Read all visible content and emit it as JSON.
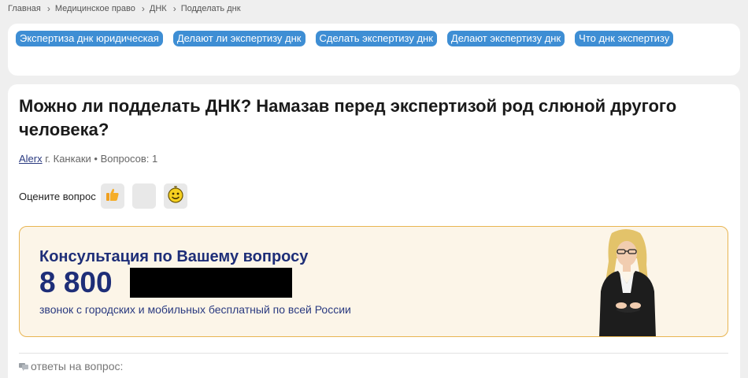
{
  "breadcrumb": {
    "items": [
      "Главная",
      "Медицинское право",
      "ДНК",
      "Подделать днк"
    ],
    "separator_icon": "chevron-right-icon"
  },
  "tags": [
    "Экспертиза днк юридическая",
    "Делают ли экспертизу днк",
    "Сделать экспертизу днк",
    "Делают экспертизу днк",
    "Что днк экспертизу"
  ],
  "question": {
    "title": "Можно ли подделать ДНК? Намазав перед экспертизой род слюной другого человека?",
    "author": "Alerx",
    "location": "г. Канкаки",
    "questions_count": "Вопросов: 1"
  },
  "rating": {
    "label": "Оцените вопрос",
    "icons": [
      "thumbs-up-icon",
      "neutral-icon",
      "smiley-icon"
    ]
  },
  "consultation": {
    "title": "Консультация по Вашему вопросу",
    "phone_prefix": "8 800",
    "phone_redacted": true,
    "subtitle": "звонок с городских и мобильных бесплатный по всей России",
    "accent_color": "#1e2e78",
    "border_color": "#e8b552"
  },
  "answers": {
    "label": "ответы на вопрос:",
    "icon": "chat-icon"
  },
  "colors": {
    "tag_bg": "#3e8ed4",
    "page_bg": "#efefef"
  }
}
